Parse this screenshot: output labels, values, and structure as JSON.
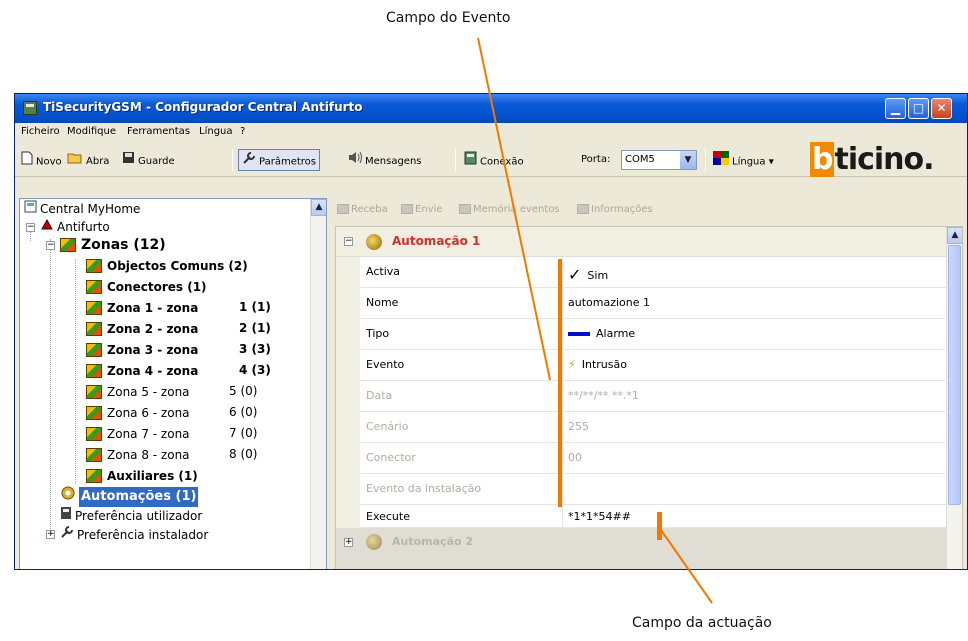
{
  "callouts": {
    "top": "Campo do Evento",
    "bottom": "Campo da actuação",
    "color": "#f07a00"
  },
  "window": {
    "title": "TiSecurityGSM - Configurador Central Antifurto",
    "controls": {
      "minimize": "▁",
      "maximize": "□",
      "close": "✕"
    }
  },
  "menu": [
    "Ficheiro",
    "Modifique",
    "Ferramentas",
    "Língua",
    "?"
  ],
  "toolbar": {
    "novo": "Novo",
    "abra": "Abra",
    "guarde": "Guarde",
    "parametros": "Parâmetros",
    "mensagens": "Mensagens",
    "conexao": "Conexão",
    "porta_label": "Porta:",
    "porta_value": "COM5",
    "lingua": "Língua",
    "logo_b": "b",
    "logo_rest": "ticino."
  },
  "tree": {
    "root": "Central MyHome",
    "antifurto": "Antifurto",
    "zonas": "Zonas (12)",
    "objectos": "Objectos Comuns (2)",
    "conectores": "Conectores (1)",
    "zones": [
      {
        "label": "Zona 1 - zona",
        "count": "1 (1)"
      },
      {
        "label": "Zona 2 - zona",
        "count": "2 (1)"
      },
      {
        "label": "Zona 3 - zona",
        "count": "3 (3)"
      },
      {
        "label": "Zona 4 - zona",
        "count": "4 (3)"
      },
      {
        "label": "Zona 5 - zona",
        "count": "5 (0)"
      },
      {
        "label": "Zona 6 - zona",
        "count": "6 (0)"
      },
      {
        "label": "Zona 7 - zona",
        "count": "7 (0)"
      },
      {
        "label": "Zona 8 - zona",
        "count": "8 (0)"
      }
    ],
    "auxiliares": "Auxiliares (1)",
    "automacoes": "Automações (1)",
    "pref_utilizador": "Preferência utilizador",
    "pref_instalador": "Preferência instalador"
  },
  "right_toolbar": {
    "receba": "Receba",
    "envie": "Envie",
    "memoria": "Memória eventos",
    "informacoes": "Informações"
  },
  "grid": {
    "group_title": "Automação 1",
    "group2_title": "Automação 2",
    "rows": [
      {
        "name": "Activa",
        "value": "Sim"
      },
      {
        "name": "Nome",
        "value": "automazione 1"
      },
      {
        "name": "Tipo",
        "value": "Alarme"
      },
      {
        "name": "Evento",
        "value": "Intrusão"
      },
      {
        "name": "Data",
        "value": "**/**/** **.*1"
      },
      {
        "name": "Cenário",
        "value": "255"
      },
      {
        "name": "Conector",
        "value": "00"
      },
      {
        "name": "Evento da instalação",
        "value": ""
      },
      {
        "name": "Execute",
        "value": "*1*1*54##"
      }
    ]
  }
}
